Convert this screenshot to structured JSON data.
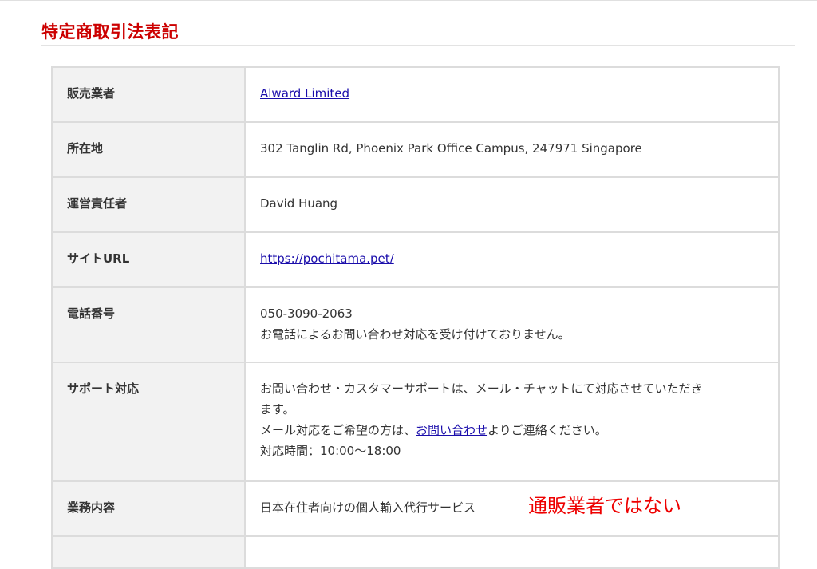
{
  "page": {
    "title": "特定商取引法表記"
  },
  "rows": [
    {
      "label": "販売業者",
      "link_text": "Alward Limited"
    },
    {
      "label": "所在地",
      "value": "302 Tanglin Rd, Phoenix Park Office Campus, 247971 Singapore"
    },
    {
      "label": "運営責任者",
      "value": "David Huang"
    },
    {
      "label": "サイトURL",
      "link_text": "https://pochitama.pet/"
    },
    {
      "label": "電話番号",
      "lines": [
        "050-3090-2063",
        "お電話によるお問い合わせ対応を受け付けておりません。"
      ]
    },
    {
      "label": "サポート対応",
      "line1": "お問い合わせ・カスタマーサポートは、メール・チャットにて対応させていただき",
      "line2": "ます。",
      "line3_before": "メール対応をご希望の方は、",
      "line3_link": "お問い合わせ",
      "line3_after": "よりご連絡ください。",
      "line4": "対応時間：10:00〜18:00"
    },
    {
      "label": "業務内容",
      "value": "日本在住者向けの個人輸入代行サービス"
    },
    {
      "label": "",
      "value": ""
    }
  ],
  "annotation": {
    "text": "通販業者ではない",
    "color": "#ee0000"
  },
  "colors": {
    "title": "#cc0000",
    "link": "#1a0dab",
    "label_bg": "#f2f2f2",
    "border": "#dcdcdc"
  }
}
